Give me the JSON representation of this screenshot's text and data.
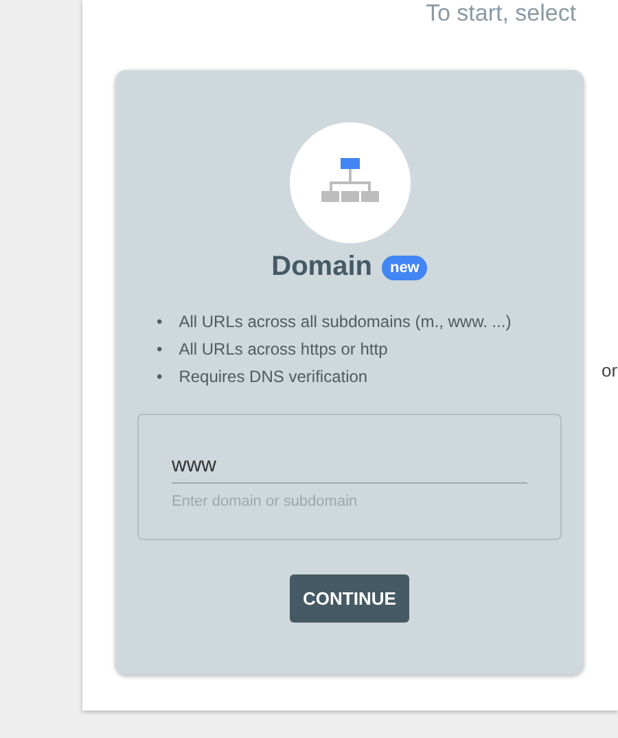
{
  "heading": "To start, select",
  "card": {
    "title": "Domain",
    "badge": "new",
    "features": [
      {
        "bullet": "•",
        "text": "All URLs across all subdomains (m., www. ...)"
      },
      {
        "bullet": "•",
        "text": "All URLs across https or http"
      },
      {
        "bullet": "•",
        "text": "Requires DNS verification"
      }
    ],
    "input": {
      "value": "www",
      "helper": "Enter domain or subdomain"
    },
    "button": "CONTINUE"
  },
  "separator": "or"
}
